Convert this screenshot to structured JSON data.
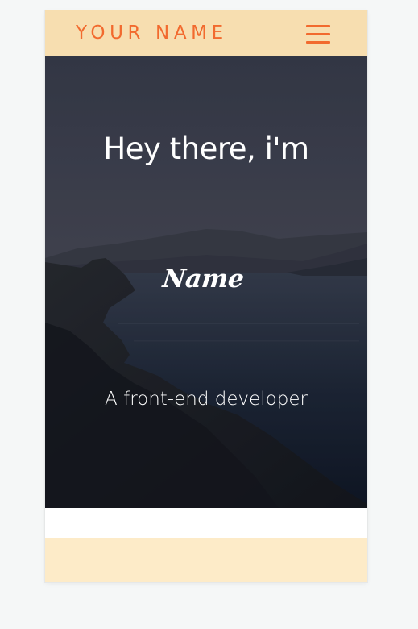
{
  "navbar": {
    "brand": "YOUR NAME",
    "menu_icon": "hamburger-menu-icon",
    "background": "#f7deb0",
    "accent": "#f26a2e"
  },
  "hero": {
    "greeting": "Hey there, i'm",
    "name": "Name",
    "role": "A front-end developer",
    "background_image": "dark lake and mountains landscape"
  },
  "footer": {
    "background": "#fdebc8"
  }
}
